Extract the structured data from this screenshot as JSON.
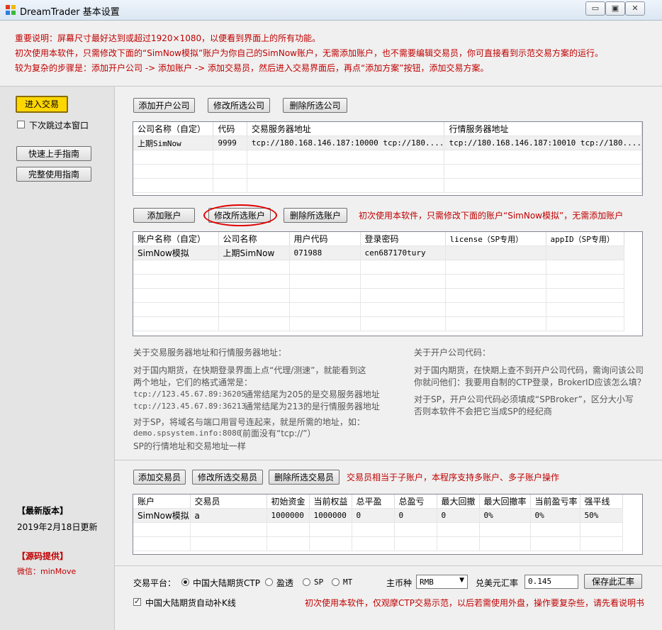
{
  "window": {
    "title": "DreamTrader 基本设置",
    "minimize": "▭",
    "restore": "▣",
    "close": "✕"
  },
  "notice": [
    "重要说明：屏幕尺寸最好达到或超过1920×1080，以便看到界面上的所有功能。",
    "初次使用本软件，只需修改下面的“SimNow模拟”账户为你自己的SimNow账户，无需添加账户，也不需要编辑交易员，你可直接看到示范交易方案的运行。",
    "较为复杂的步骤是：添加开户公司 -> 添加账户 -> 添加交易员，然后进入交易界面后，再点“添加方案”按钮，添加交易方案。"
  ],
  "sidebar": {
    "enter_trade": "进入交易",
    "skip_window": "下次跳过本窗口",
    "quick_guide": "快速上手指南",
    "full_guide": "完整使用指南",
    "latest_version_title": "【最新版本】",
    "latest_version_date": "2019年2月18日更新",
    "source_title": "【源码提供】",
    "wechat": "微信：minMove"
  },
  "company": {
    "buttons": {
      "add": "添加开户公司",
      "edit": "修改所选公司",
      "delete": "删除所选公司"
    },
    "columns": [
      "公司名称（自定）",
      "代码",
      "交易服务器地址",
      "行情服务器地址"
    ],
    "rows": [
      [
        "上期SimNow",
        "9999",
        "tcp://180.168.146.187:10000 tcp://180....",
        "tcp://180.168.146.187:10010 tcp://180...."
      ]
    ]
  },
  "account": {
    "buttons": {
      "add": "添加账户",
      "edit": "修改所选账户",
      "delete": "删除所选账户"
    },
    "tip": "初次使用本软件，只需修改下面的账户“SimNow模拟”，无需添加账户",
    "columns": [
      "账户名称（自定）",
      "公司名称",
      "用户代码",
      "登录密码",
      "license（SP专用）",
      "appID（SP专用）"
    ],
    "rows": [
      [
        "SimNow模拟",
        "上期SimNow",
        "071988",
        "cen687170tury",
        "",
        ""
      ]
    ]
  },
  "help_server": {
    "title": "关于交易服务器地址和行情服务器地址：",
    "l1": "对于国内期货，在快期登录界面上点“代理/测速”，就能看到这",
    "l2": "两个地址，它们的格式通常是：",
    "ex1_addr": "tcp://123.45.67.89:36205",
    "ex1_desc": "通常结尾为205的是交易服务器地址",
    "ex2_addr": "tcp://123.45.67.89:36213",
    "ex2_desc": "通常结尾为213的是行情服务器地址",
    "l3": "对于SP，将域名与端口用冒号连起来，就是所需的地址，如：",
    "ex3_addr": "demo.spsystem.info:8080",
    "ex3_desc": "（前面没有“tcp://”）",
    "l4": "SP的行情地址和交易地址一样"
  },
  "help_company": {
    "title": "关于开户公司代码：",
    "l1": "对于国内期货，在快期上查不到开户公司代码，需询问该公司",
    "l2": "你就问他们：我要用自制的CTP登录，BrokerID应该怎么填？",
    "l3": "对于SP，开户公司代码必须填成“SPBroker”，区分大小写",
    "l4": "否则本软件不会把它当成SP的经纪商"
  },
  "trader": {
    "buttons": {
      "add": "添加交易员",
      "edit": "修改所选交易员",
      "delete": "删除所选交易员"
    },
    "tip": "交易员相当于子账户，本程序支持多账户、多子账户操作",
    "columns": [
      "账户",
      "交易员",
      "初始资金",
      "当前权益",
      "总平盈",
      "总盈亏",
      "最大回撤",
      "最大回撤率",
      "当前盈亏率",
      "强平线"
    ],
    "rows": [
      [
        "SimNow模拟",
        "a",
        "1000000",
        "1000000",
        "0",
        "0",
        "0",
        "0%",
        "0%",
        "50%"
      ]
    ]
  },
  "bottom": {
    "platform_label": "交易平台：",
    "platforms": [
      "中国大陆期货CTP",
      "盈透",
      "SP",
      "MT"
    ],
    "currency_label": "主币种",
    "currency_value": "RMB",
    "rate_label": "兑美元汇率",
    "rate_value": "0.145",
    "save_rate": "保存此汇率",
    "auto_k": "中国大陆期货自动补K线",
    "bottom_tip": "初次使用本软件，仅观摩CTP交易示范，以后若需使用外盘，操作要复杂些，请先看说明书"
  }
}
